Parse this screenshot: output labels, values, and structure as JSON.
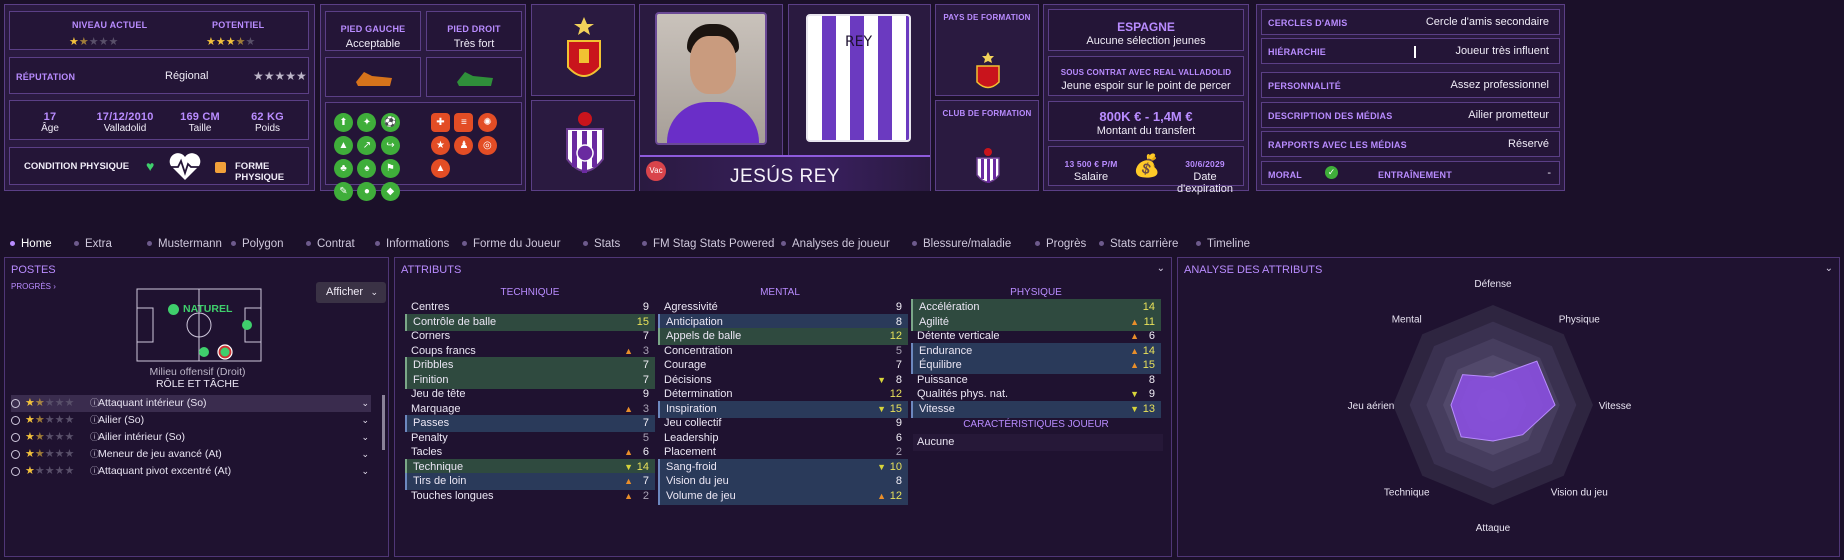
{
  "overview": {
    "current_level_label": "NIVEAU ACTUEL",
    "potential_label": "POTENTIEL",
    "current_stars": 1.5,
    "potential_stars": 3.5,
    "reputation_label": "RÉPUTATION",
    "reputation_value": "Régional",
    "age": "17",
    "age_label": "Âge",
    "dob": "17/12/2010",
    "birthplace": "Valladolid",
    "height": "169 CM",
    "height_label": "Taille",
    "weight": "62 KG",
    "weight_label": "Poids",
    "condition_label": "CONDITION PHYSIQUE",
    "form_label": "FORME PHYSIQUE"
  },
  "feet": {
    "left_label": "PIED GAUCHE",
    "left_value": "Acceptable",
    "right_label": "PIED DROIT",
    "right_value": "Très fort"
  },
  "player": {
    "name": "JESÚS REY",
    "badge": "Vac",
    "kit_text": "REY"
  },
  "training": {
    "country_label": "PAYS DE FORMATION",
    "club_label": "CLUB DE FORMATION"
  },
  "nation": {
    "name": "ESPAGNE",
    "caps": "Aucune sélection jeunes",
    "contract_label": "SOUS CONTRAT AVEC REAL VALLADOLID",
    "contract_value": "Jeune espoir sur le point de percer",
    "fee": "800K € - 1,4M €",
    "fee_label": "Montant du transfert",
    "salary": "13 500 € P/M",
    "salary_label": "Salaire",
    "expiry": "30/6/2029",
    "expiry_label": "Date d'expiration"
  },
  "social": [
    {
      "label": "CERCLES D'AMIS",
      "value": "Cercle d'amis secondaire"
    },
    {
      "label": "HIÉRARCHIE",
      "value": "Joueur très influent"
    },
    {
      "label": "PERSONNALITÉ",
      "value": "Assez professionnel"
    },
    {
      "label": "DESCRIPTION DES MÉDIAS",
      "value": "Ailier prometteur"
    },
    {
      "label": "RAPPORTS AVEC LES MÉDIAS",
      "value": "Réservé"
    }
  ],
  "morale_label": "MORAL",
  "training_status_label": "ENTRAÎNEMENT",
  "training_status_value": "-",
  "tabs": [
    "Home",
    "Extra",
    "Mustermann",
    "Polygon",
    "Contrat",
    "Informations",
    "Forme du Joueur",
    "Stats",
    "FM Stag Stats Powered",
    "Analyses de joueur",
    "Blessure/maladie",
    "Progrès",
    "Stats carrière",
    "Timeline"
  ],
  "positions": {
    "title": "POSTES",
    "progress": "PROGRÈS",
    "show_button": "Afficher",
    "natural": "NATUREL",
    "position": "Milieu offensif (Droit)",
    "role_title": "RÔLE ET TÂCHE",
    "roles": [
      {
        "name": "Attaquant intérieur (So)",
        "stars": 1.5
      },
      {
        "name": "Ailier (So)",
        "stars": 1.5
      },
      {
        "name": "Ailier intérieur (So)",
        "stars": 1.5
      },
      {
        "name": "Meneur de jeu avancé (At)",
        "stars": 1.5
      },
      {
        "name": "Attaquant pivot excentré (At)",
        "stars": 1
      }
    ]
  },
  "attributes": {
    "title": "ATTRIBUTS",
    "tech_header": "TECHNIQUE",
    "mental_header": "MENTAL",
    "phys_header": "PHYSIQUE",
    "traits_header": "CARACTÉRISTIQUES JOUEUR",
    "traits_value": "Aucune",
    "technical": [
      {
        "name": "Centres",
        "value": "9",
        "hl": "",
        "arrow": ""
      },
      {
        "name": "Contrôle de balle",
        "value": "15",
        "hl": "g",
        "arrow": ""
      },
      {
        "name": "Corners",
        "value": "7",
        "hl": "",
        "arrow": ""
      },
      {
        "name": "Coups francs",
        "value": "3",
        "hl": "",
        "arrow": "up"
      },
      {
        "name": "Dribbles",
        "value": "7",
        "hl": "g",
        "arrow": ""
      },
      {
        "name": "Finition",
        "value": "7",
        "hl": "g",
        "arrow": ""
      },
      {
        "name": "Jeu de tête",
        "value": "9",
        "hl": "",
        "arrow": ""
      },
      {
        "name": "Marquage",
        "value": "3",
        "hl": "",
        "arrow": "up"
      },
      {
        "name": "Passes",
        "value": "7",
        "hl": "b",
        "arrow": ""
      },
      {
        "name": "Penalty",
        "value": "5",
        "hl": "",
        "arrow": ""
      },
      {
        "name": "Tacles",
        "value": "6",
        "hl": "",
        "arrow": "up"
      },
      {
        "name": "Technique",
        "value": "14",
        "hl": "g",
        "arrow": "dn"
      },
      {
        "name": "Tirs de loin",
        "value": "7",
        "hl": "b",
        "arrow": "up"
      },
      {
        "name": "Touches longues",
        "value": "2",
        "hl": "",
        "arrow": "up"
      }
    ],
    "mental": [
      {
        "name": "Agressivité",
        "value": "9",
        "hl": "",
        "arrow": ""
      },
      {
        "name": "Anticipation",
        "value": "8",
        "hl": "b",
        "arrow": ""
      },
      {
        "name": "Appels de balle",
        "value": "12",
        "hl": "g",
        "arrow": ""
      },
      {
        "name": "Concentration",
        "value": "5",
        "hl": "",
        "arrow": ""
      },
      {
        "name": "Courage",
        "value": "7",
        "hl": "",
        "arrow": ""
      },
      {
        "name": "Décisions",
        "value": "8",
        "hl": "",
        "arrow": "dn"
      },
      {
        "name": "Détermination",
        "value": "12",
        "hl": "",
        "arrow": ""
      },
      {
        "name": "Inspiration",
        "value": "15",
        "hl": "b",
        "arrow": "dn"
      },
      {
        "name": "Jeu collectif",
        "value": "9",
        "hl": "",
        "arrow": ""
      },
      {
        "name": "Leadership",
        "value": "6",
        "hl": "",
        "arrow": ""
      },
      {
        "name": "Placement",
        "value": "2",
        "hl": "",
        "arrow": ""
      },
      {
        "name": "Sang-froid",
        "value": "10",
        "hl": "b",
        "arrow": "dn"
      },
      {
        "name": "Vision du jeu",
        "value": "8",
        "hl": "b",
        "arrow": ""
      },
      {
        "name": "Volume de jeu",
        "value": "12",
        "hl": "b",
        "arrow": "up"
      }
    ],
    "physical": [
      {
        "name": "Accélération",
        "value": "14",
        "hl": "g",
        "arrow": ""
      },
      {
        "name": "Agilité",
        "value": "11",
        "hl": "g",
        "arrow": "up"
      },
      {
        "name": "Détente verticale",
        "value": "6",
        "hl": "",
        "arrow": "up"
      },
      {
        "name": "Endurance",
        "value": "14",
        "hl": "b",
        "arrow": "up"
      },
      {
        "name": "Équilibre",
        "value": "15",
        "hl": "b",
        "arrow": "up"
      },
      {
        "name": "Puissance",
        "value": "8",
        "hl": "",
        "arrow": ""
      },
      {
        "name": "Qualités phys. nat.",
        "value": "9",
        "hl": "",
        "arrow": "dn"
      },
      {
        "name": "Vitesse",
        "value": "13",
        "hl": "b",
        "arrow": "dn"
      }
    ]
  },
  "analysis": {
    "title": "ANALYSE DES ATTRIBUTS",
    "axes": [
      "Défense",
      "Physique",
      "Vitesse",
      "Vision du jeu",
      "Attaque",
      "Technique",
      "Jeu aérien",
      "Mental"
    ],
    "values": [
      0.28,
      0.62,
      0.62,
      0.42,
      0.36,
      0.45,
      0.42,
      0.43
    ]
  },
  "colors": {
    "accent": "#b98cff",
    "panel": "#241537",
    "green": "#3fae3a",
    "orange": "#e34d25"
  }
}
